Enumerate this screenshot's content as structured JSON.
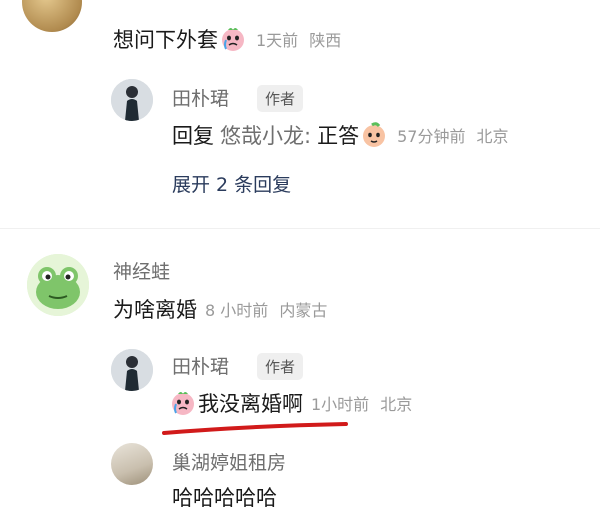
{
  "comments": [
    {
      "text": "想问下外套",
      "emoji": "crying-face-emoji",
      "time": "1天前",
      "location": "陕西",
      "replies": [
        {
          "author": "田朴珺",
          "badge": "作者",
          "prefix": "回复",
          "reply_to": "悠哉小龙:",
          "text": "正答",
          "emoji": "peach-face-emoji",
          "time": "57分钟前",
          "location": "北京"
        }
      ],
      "expand_label": "展开 2 条回复"
    },
    {
      "author": "神经蛙",
      "text": "为啥离婚",
      "time": "8 小时前",
      "location": "内蒙古",
      "replies": [
        {
          "author": "田朴珺",
          "badge": "作者",
          "emoji": "crying-face-emoji",
          "text": "我没离婚啊",
          "time": "1小时前",
          "location": "北京"
        },
        {
          "author": "巢湖婷姐租房",
          "text": "哈哈哈哈哈"
        }
      ]
    }
  ],
  "colors": {
    "underline": "#d11a1a",
    "expand": "#2a3b5c",
    "meta": "#9a9a9a"
  }
}
